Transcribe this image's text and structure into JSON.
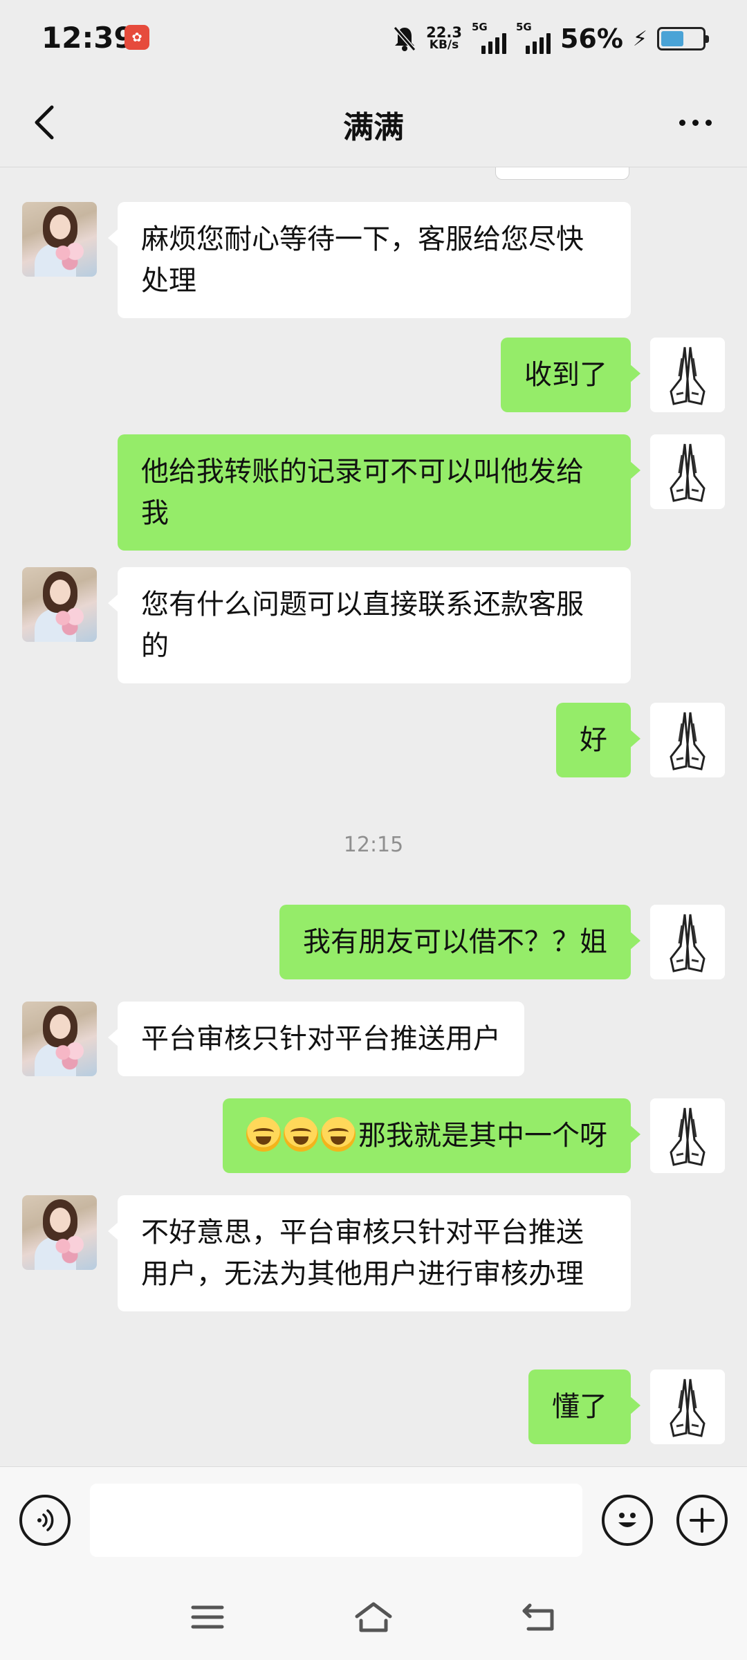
{
  "status_bar": {
    "time": "12:39",
    "net_speed_value": "22.3",
    "net_speed_unit": "KB/s",
    "signal_1_tag": "5G",
    "signal_2_tag": "5G",
    "battery_percent": "56%",
    "battery_level": 0.56
  },
  "header": {
    "title": "满满",
    "back_icon": "chevron-left-icon",
    "more_icon": "more-dots-icon"
  },
  "messages": [
    {
      "side": "left",
      "text": "麻烦您耐心等待一下，客服给您尽快处理"
    },
    {
      "side": "right",
      "text": "收到了"
    },
    {
      "side": "right",
      "text": "他给我转账的记录可不可以叫他发给我"
    },
    {
      "side": "left",
      "text": "您有什么问题可以直接联系还款客服的"
    },
    {
      "side": "right",
      "text": "好"
    },
    {
      "type": "time",
      "text": "12:15"
    },
    {
      "side": "right",
      "text": "我有朋友可以借不？？姐"
    },
    {
      "side": "left",
      "text": "平台审核只针对平台推送用户"
    },
    {
      "side": "right",
      "text": "那我就是其中一个呀",
      "emoji_prefix": "laugh-cry-emoji x3"
    },
    {
      "side": "left",
      "text": "不好意思，平台审核只针对平台推送用户，无法为其他用户进行审核办理"
    },
    {
      "side": "right",
      "text": "懂了"
    }
  ],
  "input_bar": {
    "placeholder": "",
    "voice_icon": "voice-icon",
    "emoji_icon": "emoji-icon",
    "plus_icon": "plus-icon"
  },
  "colors": {
    "background": "#ededed",
    "sent_bubble": "#95ec69",
    "received_bubble": "#ffffff"
  }
}
